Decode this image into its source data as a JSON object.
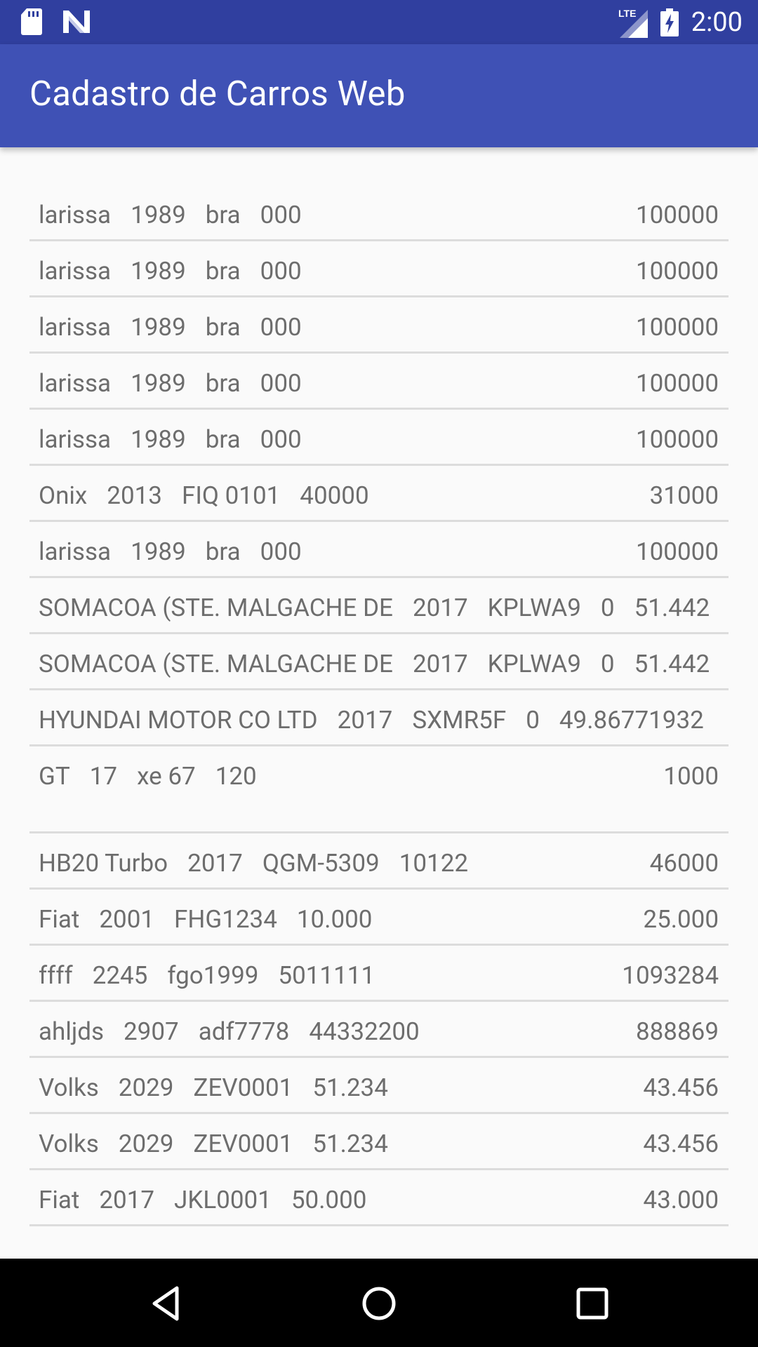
{
  "status_bar": {
    "time": "2:00",
    "network": "LTE",
    "icons": [
      "sd-card-icon",
      "n-logo-icon",
      "lte-signal-icon",
      "battery-charging-icon"
    ]
  },
  "app_bar": {
    "title": "Cadastro de Carros Web"
  },
  "cars": [
    {
      "fields": [
        "larissa",
        "1989",
        "bra",
        "000"
      ],
      "value": "100000"
    },
    {
      "fields": [
        "larissa",
        "1989",
        "bra",
        "000"
      ],
      "value": "100000"
    },
    {
      "fields": [
        "larissa",
        "1989",
        "bra",
        "000"
      ],
      "value": "100000"
    },
    {
      "fields": [
        "larissa",
        "1989",
        "bra",
        "000"
      ],
      "value": "100000"
    },
    {
      "fields": [
        "larissa",
        "1989",
        "bra",
        "000"
      ],
      "value": "100000"
    },
    {
      "fields": [
        "Onix",
        "2013",
        "FIQ 0101",
        "40000"
      ],
      "value": "31000"
    },
    {
      "fields": [
        "larissa",
        "1989",
        "bra",
        "000"
      ],
      "value": "100000"
    },
    {
      "fields": [
        "SOMACOA (STE. MALGACHE DE",
        "2017",
        "KPLWA9",
        "0",
        "51.442"
      ],
      "value": ""
    },
    {
      "fields": [
        "SOMACOA (STE. MALGACHE DE",
        "2017",
        "KPLWA9",
        "0",
        "51.442"
      ],
      "value": ""
    },
    {
      "fields": [
        "HYUNDAI MOTOR CO LTD",
        "2017",
        "SXMR5F",
        "0",
        "49.86771932"
      ],
      "value": ""
    },
    {
      "fields": [
        "GT ",
        "17",
        "xe 67",
        "120"
      ],
      "value": "1000"
    },
    {
      "fields": [
        "HB20 Turbo",
        "2017",
        "QGM-5309",
        "10122"
      ],
      "value": "46000"
    },
    {
      "fields": [
        "Fiat",
        "2001",
        "FHG1234",
        "10.000"
      ],
      "value": "25.000"
    },
    {
      "fields": [
        "ffff",
        "2245",
        "fgo1999",
        "5011111"
      ],
      "value": "1093284"
    },
    {
      "fields": [
        "ahljds",
        "2907",
        "adf7778",
        "44332200"
      ],
      "value": "888869"
    },
    {
      "fields": [
        "Volks",
        "2029",
        "ZEV0001",
        "51.234"
      ],
      "value": "43.456"
    },
    {
      "fields": [
        "Volks",
        "2029",
        "ZEV0001",
        "51.234"
      ],
      "value": "43.456"
    },
    {
      "fields": [
        "Fiat",
        "2017",
        "JKL0001",
        "50.000"
      ],
      "value": "43.000"
    }
  ],
  "nav_bar": {
    "buttons": [
      "back-icon",
      "home-icon",
      "recents-icon"
    ]
  },
  "colors": {
    "status_bar": "#303f9f",
    "app_bar": "#3f51b5",
    "background": "#fafafa",
    "text": "#6d6d6d"
  }
}
